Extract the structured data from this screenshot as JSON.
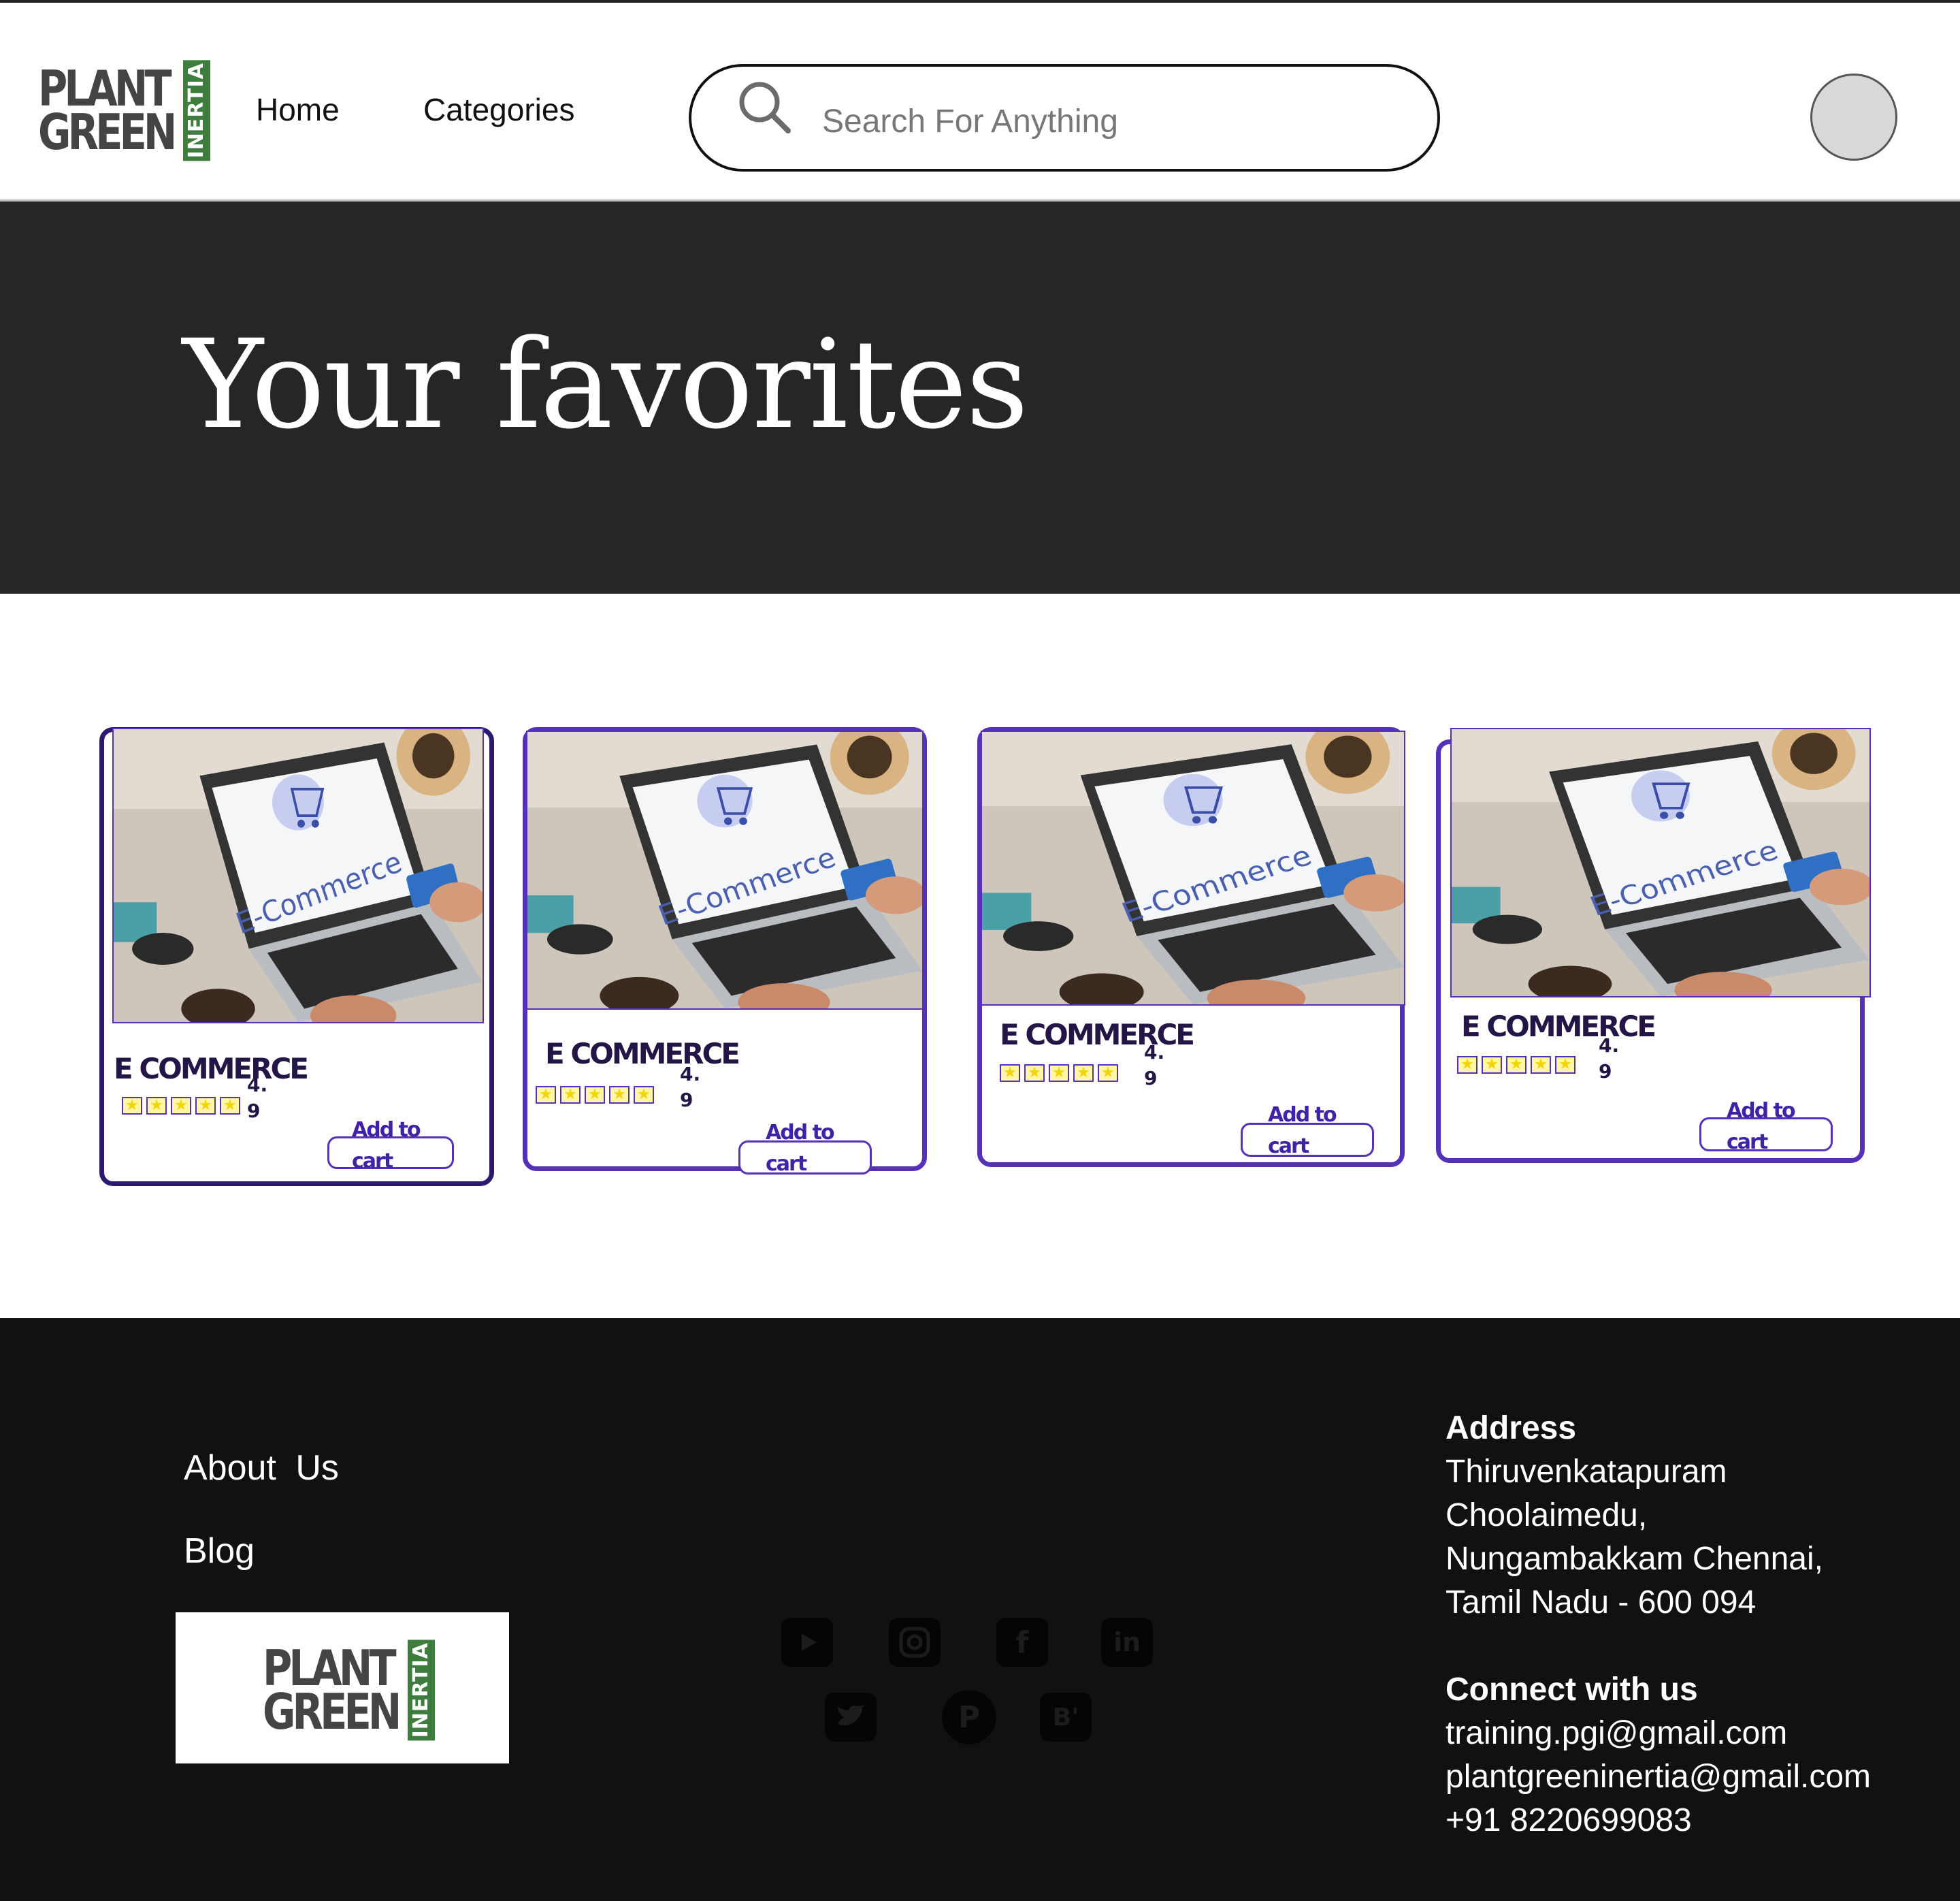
{
  "brand": {
    "logo_line1": "PLANT",
    "logo_line2": "GREEN",
    "logo_tag": "INERTIA",
    "accent": "#5431b8",
    "logo_green": "#3f7d3f"
  },
  "nav": {
    "home": "Home",
    "categories": "Categories"
  },
  "search": {
    "placeholder": "Search For Anything"
  },
  "hero": {
    "title": "Your favorites"
  },
  "products": [
    {
      "image_text": "E-Commerce",
      "title": "E  COMMERCE",
      "rating": "4.9",
      "stars": 5,
      "cart_label": "Add to cart"
    },
    {
      "image_text": "E-Commerce",
      "title": "E COMMERCE",
      "rating": "4.9",
      "stars": 5,
      "cart_label": "Add to cart"
    },
    {
      "image_text": "E-Commerce",
      "title": "E COMMERCE",
      "rating": "4.9",
      "stars": 5,
      "cart_label": "Add to cart"
    },
    {
      "image_text": "E-Commerce",
      "title": "E COMMERCE",
      "rating": "4.9",
      "stars": 5,
      "cart_label": "Add to cart"
    }
  ],
  "footer": {
    "about": "About  Us",
    "blog": "Blog",
    "social": [
      "youtube-icon",
      "instagram-icon",
      "facebook-icon",
      "linkedin-icon",
      "twitter-icon",
      "pinterest-icon",
      "behance-icon"
    ],
    "address_heading": "Address",
    "address_lines": [
      "Thiruvenkatapuram",
      "Choolaimedu,",
      "Nungambakkam Chennai,",
      "Tamil Nadu - 600 094"
    ],
    "connect_heading": "Connect with us",
    "contacts": [
      "training.pgi@gmail.com",
      "plantgreeninertia@gmail.com",
      "+91 8220699083"
    ]
  }
}
